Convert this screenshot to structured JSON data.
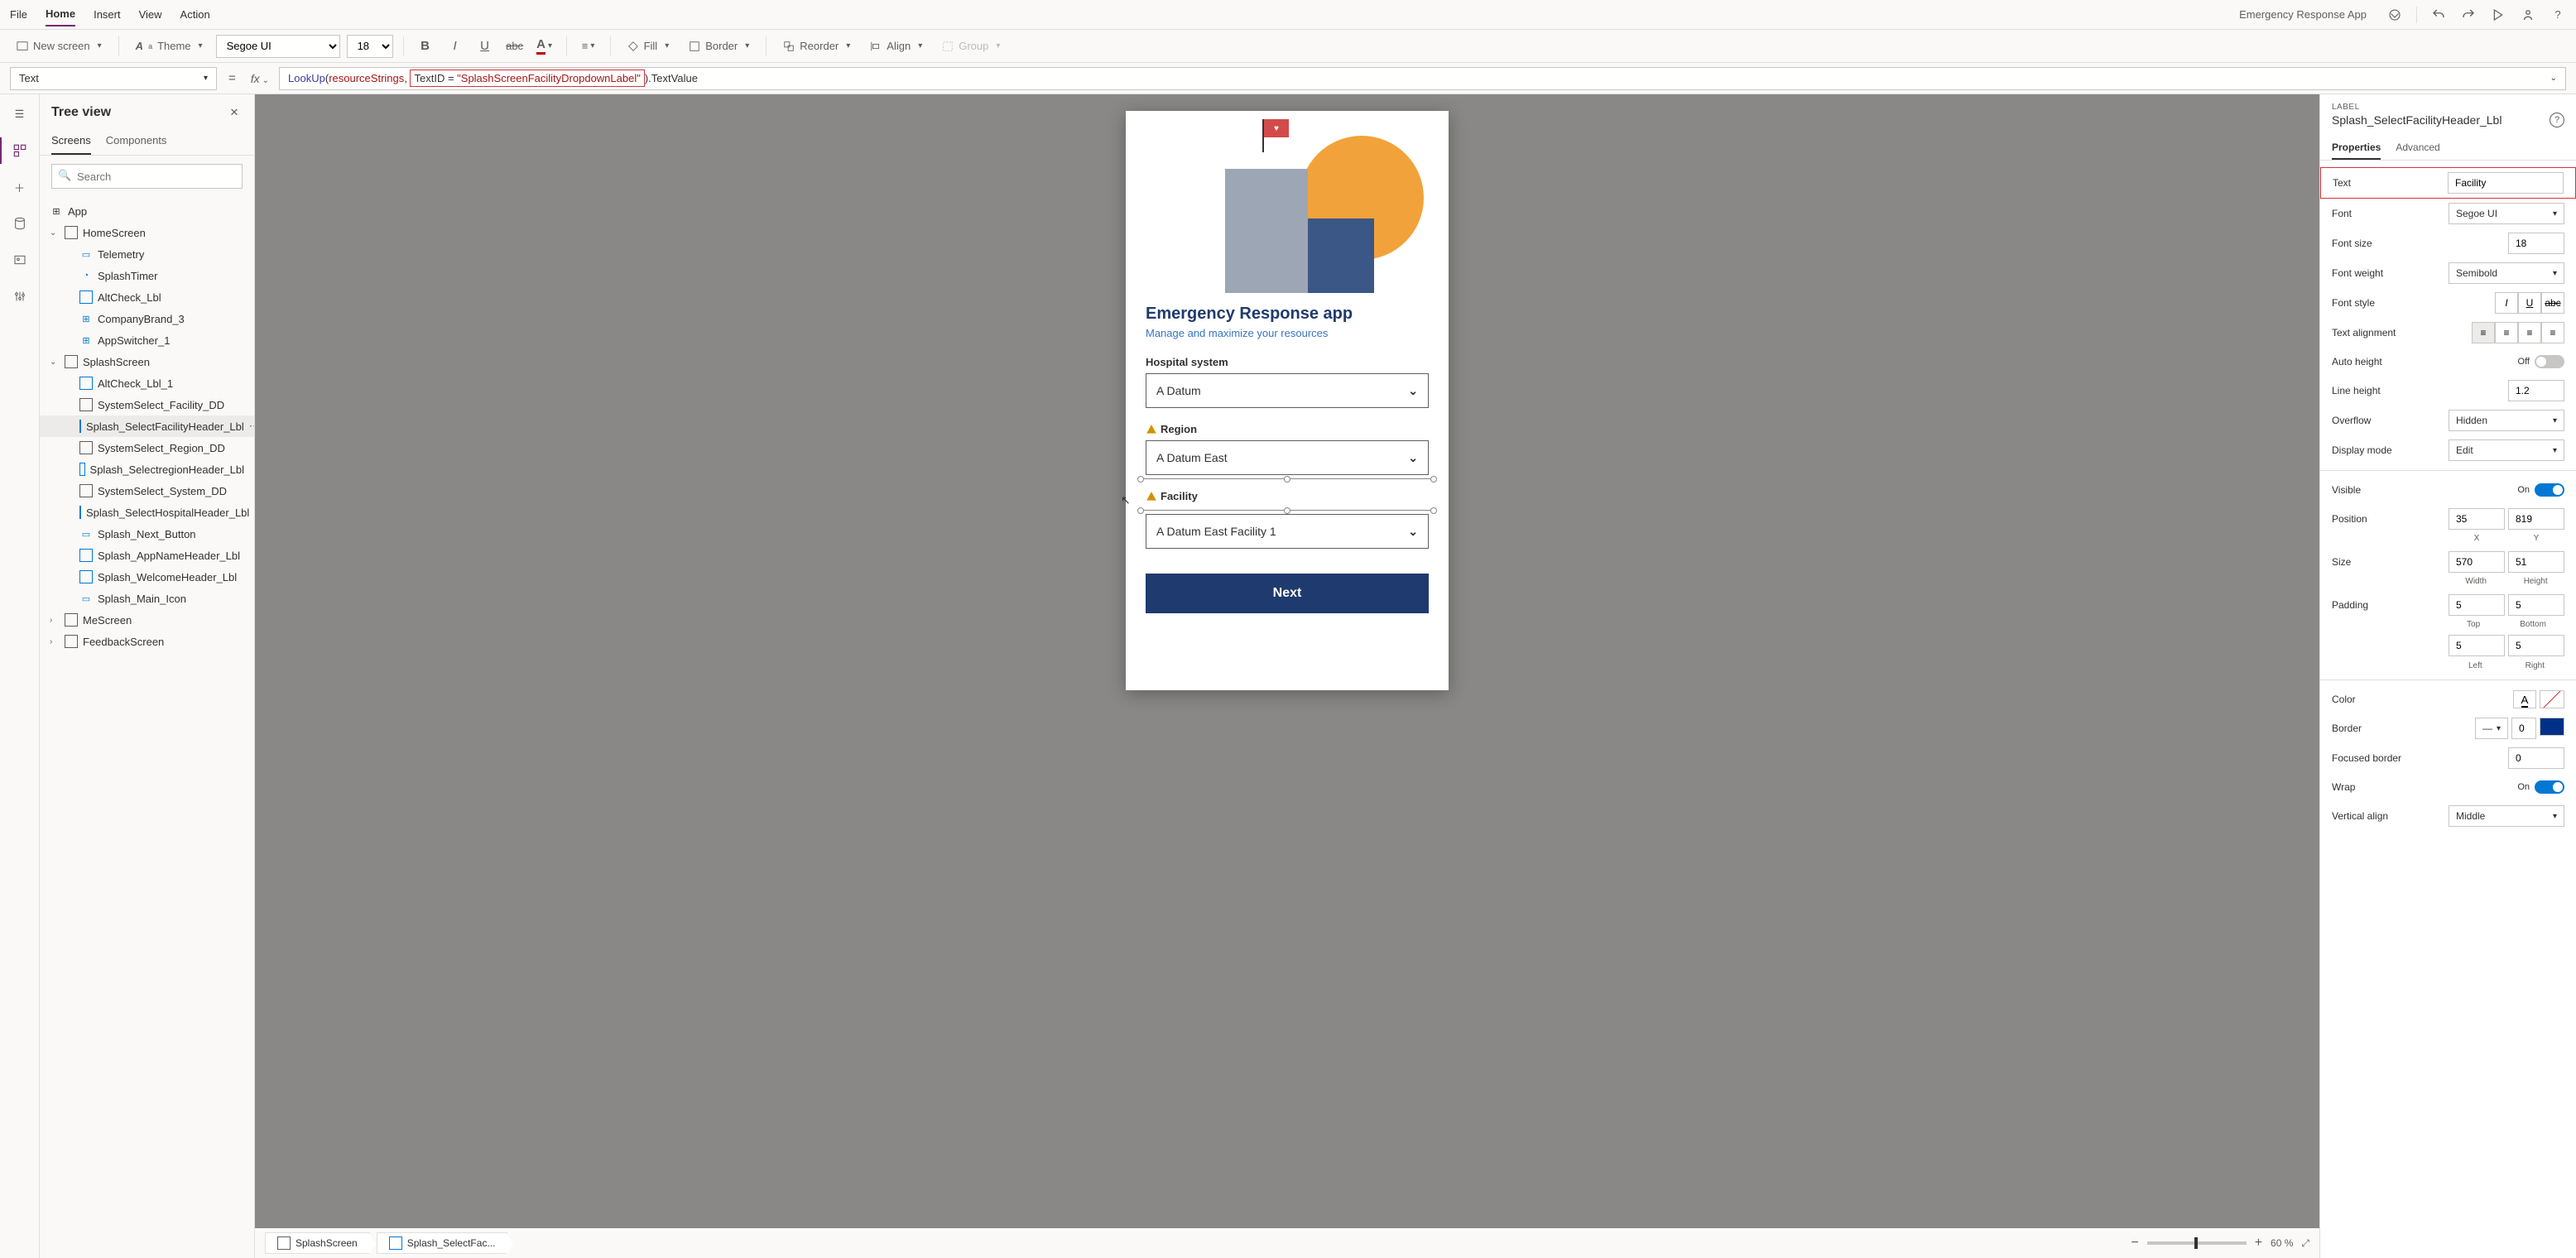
{
  "appName": "Emergency Response App",
  "menu": {
    "file": "File",
    "home": "Home",
    "insert": "Insert",
    "view": "View",
    "action": "Action"
  },
  "ribbon": {
    "newScreen": "New screen",
    "theme": "Theme",
    "font": "Segoe UI",
    "fontSize": "18",
    "fill": "Fill",
    "border": "Border",
    "reorder": "Reorder",
    "align": "Align",
    "group": "Group"
  },
  "formulaBar": {
    "property": "Text",
    "fn": "LookUp",
    "collection": "resourceStrings",
    "filterField": "TextID",
    "filterValue": "\"SplashScreenFacilityDropdownLabel\"",
    "resultField": "TextValue"
  },
  "treeView": {
    "title": "Tree view",
    "tabs": {
      "screens": "Screens",
      "components": "Components"
    },
    "searchPlaceholder": "Search",
    "app": "App",
    "nodes": {
      "home": "HomeScreen",
      "telemetry": "Telemetry",
      "splashTimer": "SplashTimer",
      "altCheck": "AltCheck_Lbl",
      "companyBrand": "CompanyBrand_3",
      "appSwitcher": "AppSwitcher_1",
      "splash": "SplashScreen",
      "altCheck1": "AltCheck_Lbl_1",
      "facilityDD": "SystemSelect_Facility_DD",
      "facilityHeader": "Splash_SelectFacilityHeader_Lbl",
      "regionDD": "SystemSelect_Region_DD",
      "regionHeader": "Splash_SelectregionHeader_Lbl",
      "systemDD": "SystemSelect_System_DD",
      "hospitalHeader": "Splash_SelectHospitalHeader_Lbl",
      "nextBtn": "Splash_Next_Button",
      "appNameHeader": "Splash_AppNameHeader_Lbl",
      "welcomeHeader": "Splash_WelcomeHeader_Lbl",
      "mainIcon": "Splash_Main_Icon",
      "me": "MeScreen",
      "feedback": "FeedbackScreen"
    }
  },
  "canvas": {
    "appTitle": "Emergency Response app",
    "appSubtitle": "Manage and maximize your resources",
    "labels": {
      "hospital": "Hospital system",
      "region": "Region",
      "facility": "Facility"
    },
    "values": {
      "hospital": "A Datum",
      "region": "A Datum East",
      "facility": "A Datum East Facility 1"
    },
    "nextButton": "Next",
    "breadcrumb": {
      "screen": "SplashScreen",
      "control": "Splash_SelectFac..."
    },
    "zoom": "60 %"
  },
  "props": {
    "type": "LABEL",
    "name": "Splash_SelectFacilityHeader_Lbl",
    "tabs": {
      "properties": "Properties",
      "advanced": "Advanced"
    },
    "rows": {
      "text": {
        "label": "Text",
        "value": "Facility"
      },
      "font": {
        "label": "Font",
        "value": "Segoe UI"
      },
      "fontSize": {
        "label": "Font size",
        "value": "18"
      },
      "fontWeight": {
        "label": "Font weight",
        "value": "Semibold"
      },
      "fontStyle": {
        "label": "Font style"
      },
      "textAlign": {
        "label": "Text alignment"
      },
      "autoHeight": {
        "label": "Auto height",
        "state": "Off"
      },
      "lineHeight": {
        "label": "Line height",
        "value": "1.2"
      },
      "overflow": {
        "label": "Overflow",
        "value": "Hidden"
      },
      "displayMode": {
        "label": "Display mode",
        "value": "Edit"
      },
      "visible": {
        "label": "Visible",
        "state": "On"
      },
      "position": {
        "label": "Position",
        "x": "35",
        "y": "819",
        "xLabel": "X",
        "yLabel": "Y"
      },
      "size": {
        "label": "Size",
        "w": "570",
        "h": "51",
        "wLabel": "Width",
        "hLabel": "Height"
      },
      "padding": {
        "label": "Padding",
        "top": "5",
        "bottom": "5",
        "left": "5",
        "right": "5",
        "topLabel": "Top",
        "bottomLabel": "Bottom",
        "leftLabel": "Left",
        "rightLabel": "Right"
      },
      "color": {
        "label": "Color"
      },
      "border": {
        "label": "Border",
        "value": "0"
      },
      "focusedBorder": {
        "label": "Focused border",
        "value": "0"
      },
      "wrap": {
        "label": "Wrap",
        "state": "On"
      },
      "verticalAlign": {
        "label": "Vertical align",
        "value": "Middle"
      }
    }
  }
}
